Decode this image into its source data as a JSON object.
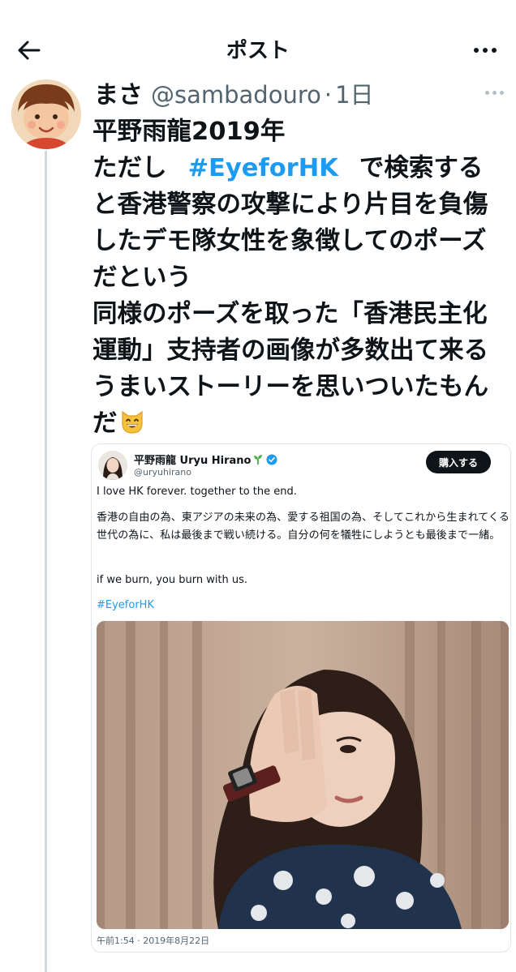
{
  "header": {
    "title": "ポスト",
    "back_icon": "back-arrow-icon",
    "more_icon": "more-horizontal-icon"
  },
  "post": {
    "name": "まさ",
    "handle": "@sambadouro",
    "separator": "·",
    "time": "1日",
    "lines": [
      "平野雨龍2019年",
      "ただし",
      "で検索する",
      "と香港警察の攻撃により片目を負傷",
      "したデモ隊女性を象徴してのポーズ",
      "だという",
      "同様のポーズを取った「香港民主化",
      "運動」支持者の画像が多数出て来る",
      "うまいストーリーを思いついたもん",
      "だ"
    ],
    "hashtag": "#EyeforHK",
    "emoji": "grinning-cat-icon"
  },
  "embedded": {
    "name": "平野雨龍 Uryu Hirano",
    "handle": "@uryuhirano",
    "buy_label": "購入する",
    "p1": "I love HK forever. together to the end.",
    "p2": "香港の自由の為、東アジアの未来の為、愛する祖国の為、そしてこれから生まれてくる世代の為に、私は最後まで戦い続ける。自分の何を犠牲にしようとも最後まで一緒。",
    "p3": "if we burn, you burn with us.",
    "hashtag": "#EyeforHK",
    "timestamp": "午前1:54 · 2019年8月22日"
  },
  "colors": {
    "accent": "#1d9bf0",
    "text": "#0f1419",
    "muted": "#536471"
  }
}
